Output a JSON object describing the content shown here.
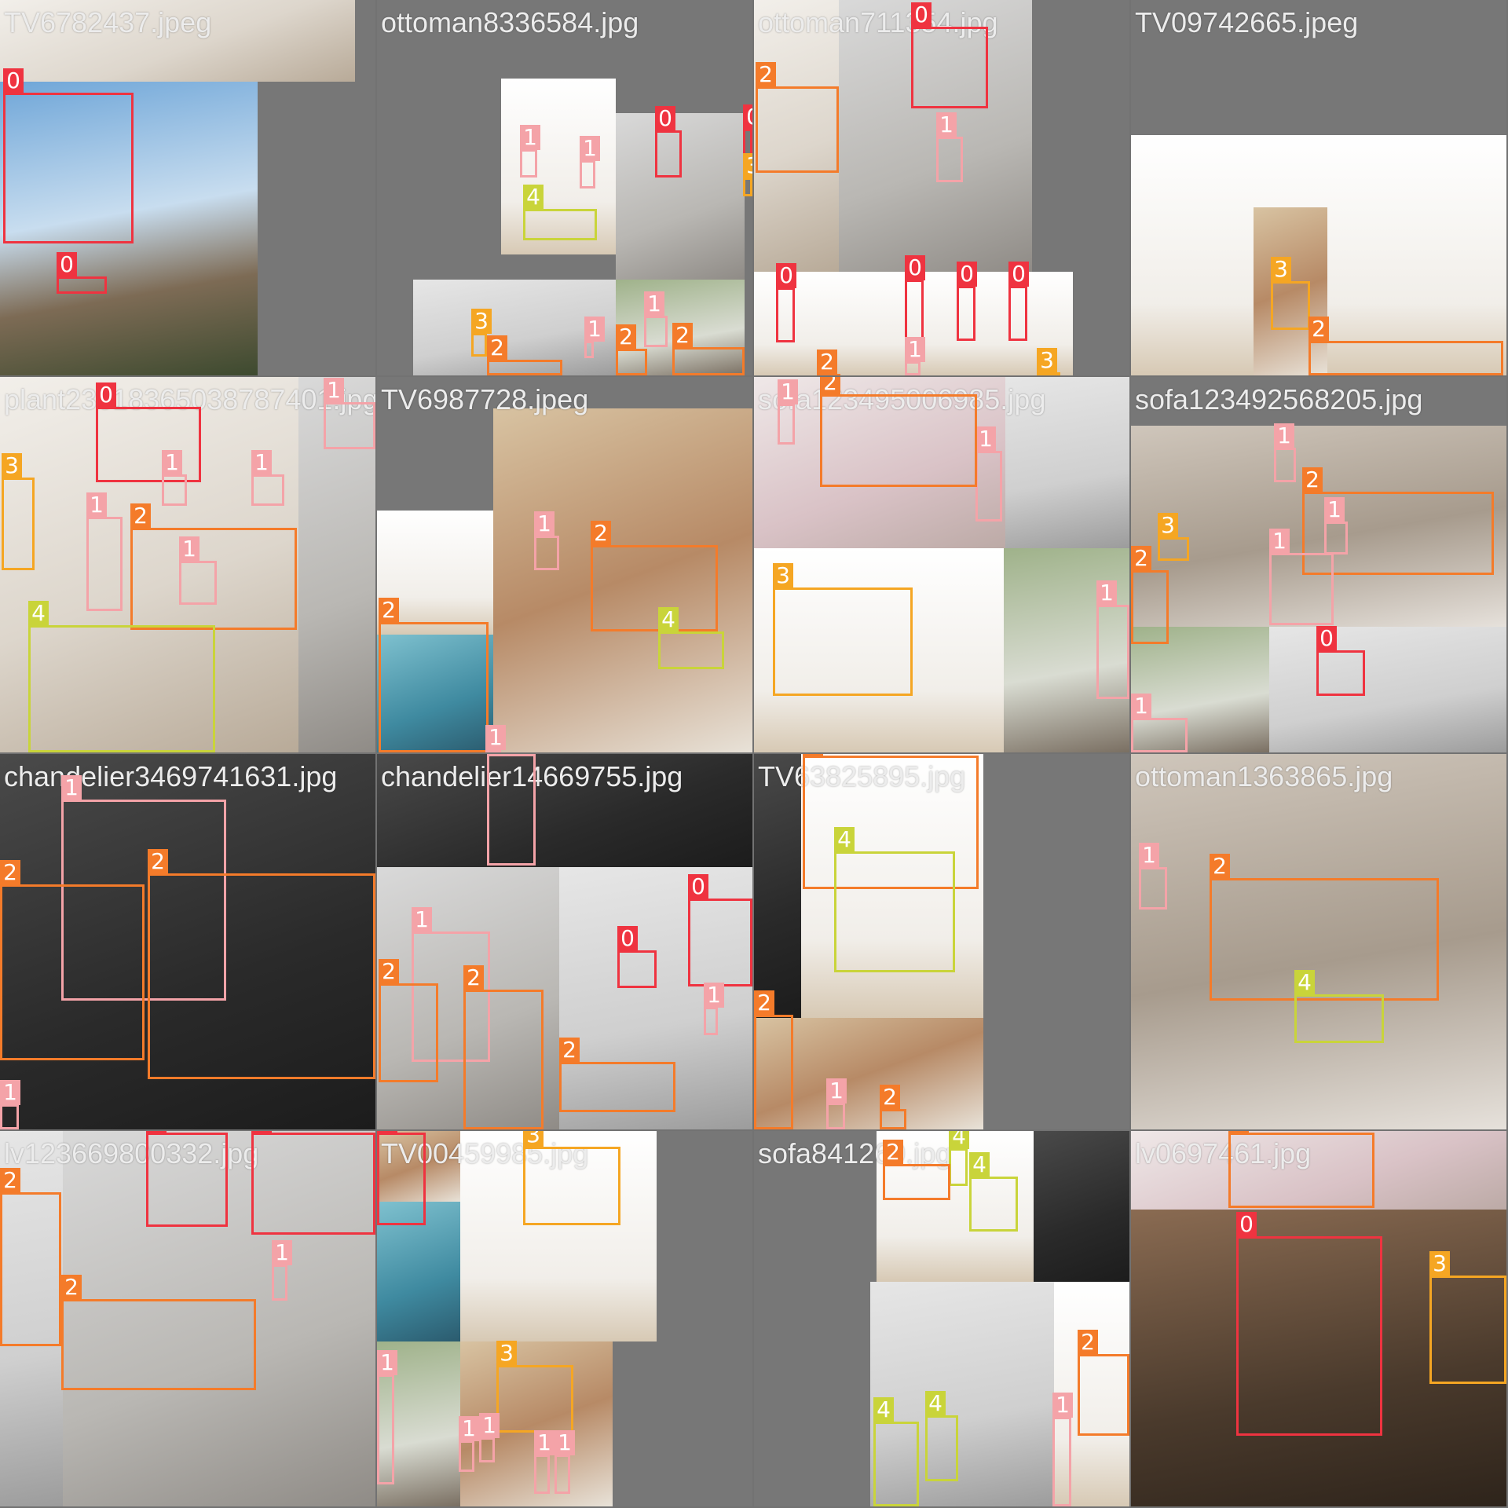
{
  "tiles": [
    {
      "id": "t1",
      "filename": "TV6782437.jpeg",
      "labels": [
        "0",
        "0"
      ]
    },
    {
      "id": "t2",
      "filename": "ottoman8336584.jpg",
      "labels": [
        "1",
        "1",
        "4",
        "0",
        "0",
        "3",
        "3",
        "2",
        "1",
        "1",
        "2",
        "2"
      ]
    },
    {
      "id": "t3",
      "filename": "ottoman711354.jpg",
      "labels": [
        "0",
        "2",
        "1",
        "0",
        "0",
        "0",
        "0",
        "2",
        "1",
        "3"
      ]
    },
    {
      "id": "t4",
      "filename": "TV09742665.jpeg",
      "labels": [
        "3",
        "2"
      ]
    },
    {
      "id": "t5",
      "filename": "plant23618365038787401.jpg",
      "labels": [
        "0",
        "1",
        "3",
        "1",
        "1",
        "1",
        "2",
        "1",
        "4"
      ]
    },
    {
      "id": "t6",
      "filename": "TV6987728.jpeg",
      "labels": [
        "1",
        "2",
        "2",
        "4",
        "1"
      ]
    },
    {
      "id": "t7",
      "filename": "sofa123495006985.jpg",
      "labels": [
        "1",
        "1",
        "3",
        "1",
        "2"
      ]
    },
    {
      "id": "t8",
      "filename": "sofa123492568205.jpg",
      "labels": [
        "1",
        "2",
        "3",
        "1",
        "1",
        "2",
        "0",
        "1"
      ]
    },
    {
      "id": "t9",
      "filename": "chandelier3469741631.jpg",
      "labels": [
        "1",
        "2",
        "2",
        "1"
      ]
    },
    {
      "id": "t10",
      "filename": "chandelier14669755.jpg",
      "labels": [
        "1",
        "0",
        "0",
        "1",
        "2",
        "2",
        "1",
        "2"
      ]
    },
    {
      "id": "t11",
      "filename": "TV63825895.jpg",
      "labels": [
        "2",
        "4",
        "2",
        "1",
        "2"
      ]
    },
    {
      "id": "t12",
      "filename": "ottoman1363865.jpg",
      "labels": [
        "1",
        "2",
        "4"
      ]
    },
    {
      "id": "t13",
      "filename": "lv123669800332.jpg",
      "labels": [
        "0",
        "0",
        "2",
        "1",
        "2"
      ]
    },
    {
      "id": "t14",
      "filename": "TV00459985.jpg",
      "labels": [
        "0",
        "3",
        "3",
        "1",
        "1",
        "1",
        "1",
        "1"
      ]
    },
    {
      "id": "t15",
      "filename": "sofa841269.jpg",
      "labels": [
        "4",
        "4",
        "2",
        "4",
        "4",
        "2",
        "1"
      ]
    },
    {
      "id": "t16",
      "filename": "lv0697461.jpg",
      "labels": [
        "2",
        "0",
        "3"
      ]
    }
  ]
}
